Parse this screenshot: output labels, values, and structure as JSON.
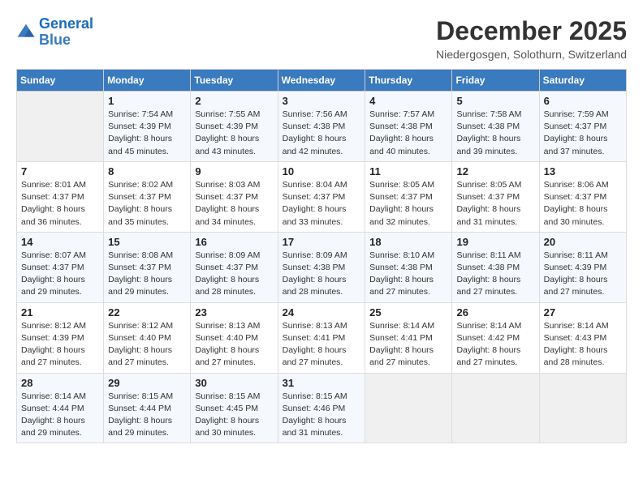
{
  "header": {
    "logo_line1": "General",
    "logo_line2": "Blue",
    "month_title": "December 2025",
    "location": "Niedergosgen, Solothurn, Switzerland"
  },
  "days_of_week": [
    "Sunday",
    "Monday",
    "Tuesday",
    "Wednesday",
    "Thursday",
    "Friday",
    "Saturday"
  ],
  "weeks": [
    [
      {
        "day": "",
        "sunrise": "",
        "sunset": "",
        "daylight": ""
      },
      {
        "day": "1",
        "sunrise": "Sunrise: 7:54 AM",
        "sunset": "Sunset: 4:39 PM",
        "daylight": "Daylight: 8 hours and 45 minutes."
      },
      {
        "day": "2",
        "sunrise": "Sunrise: 7:55 AM",
        "sunset": "Sunset: 4:39 PM",
        "daylight": "Daylight: 8 hours and 43 minutes."
      },
      {
        "day": "3",
        "sunrise": "Sunrise: 7:56 AM",
        "sunset": "Sunset: 4:38 PM",
        "daylight": "Daylight: 8 hours and 42 minutes."
      },
      {
        "day": "4",
        "sunrise": "Sunrise: 7:57 AM",
        "sunset": "Sunset: 4:38 PM",
        "daylight": "Daylight: 8 hours and 40 minutes."
      },
      {
        "day": "5",
        "sunrise": "Sunrise: 7:58 AM",
        "sunset": "Sunset: 4:38 PM",
        "daylight": "Daylight: 8 hours and 39 minutes."
      },
      {
        "day": "6",
        "sunrise": "Sunrise: 7:59 AM",
        "sunset": "Sunset: 4:37 PM",
        "daylight": "Daylight: 8 hours and 37 minutes."
      }
    ],
    [
      {
        "day": "7",
        "sunrise": "Sunrise: 8:01 AM",
        "sunset": "Sunset: 4:37 PM",
        "daylight": "Daylight: 8 hours and 36 minutes."
      },
      {
        "day": "8",
        "sunrise": "Sunrise: 8:02 AM",
        "sunset": "Sunset: 4:37 PM",
        "daylight": "Daylight: 8 hours and 35 minutes."
      },
      {
        "day": "9",
        "sunrise": "Sunrise: 8:03 AM",
        "sunset": "Sunset: 4:37 PM",
        "daylight": "Daylight: 8 hours and 34 minutes."
      },
      {
        "day": "10",
        "sunrise": "Sunrise: 8:04 AM",
        "sunset": "Sunset: 4:37 PM",
        "daylight": "Daylight: 8 hours and 33 minutes."
      },
      {
        "day": "11",
        "sunrise": "Sunrise: 8:05 AM",
        "sunset": "Sunset: 4:37 PM",
        "daylight": "Daylight: 8 hours and 32 minutes."
      },
      {
        "day": "12",
        "sunrise": "Sunrise: 8:05 AM",
        "sunset": "Sunset: 4:37 PM",
        "daylight": "Daylight: 8 hours and 31 minutes."
      },
      {
        "day": "13",
        "sunrise": "Sunrise: 8:06 AM",
        "sunset": "Sunset: 4:37 PM",
        "daylight": "Daylight: 8 hours and 30 minutes."
      }
    ],
    [
      {
        "day": "14",
        "sunrise": "Sunrise: 8:07 AM",
        "sunset": "Sunset: 4:37 PM",
        "daylight": "Daylight: 8 hours and 29 minutes."
      },
      {
        "day": "15",
        "sunrise": "Sunrise: 8:08 AM",
        "sunset": "Sunset: 4:37 PM",
        "daylight": "Daylight: 8 hours and 29 minutes."
      },
      {
        "day": "16",
        "sunrise": "Sunrise: 8:09 AM",
        "sunset": "Sunset: 4:37 PM",
        "daylight": "Daylight: 8 hours and 28 minutes."
      },
      {
        "day": "17",
        "sunrise": "Sunrise: 8:09 AM",
        "sunset": "Sunset: 4:38 PM",
        "daylight": "Daylight: 8 hours and 28 minutes."
      },
      {
        "day": "18",
        "sunrise": "Sunrise: 8:10 AM",
        "sunset": "Sunset: 4:38 PM",
        "daylight": "Daylight: 8 hours and 27 minutes."
      },
      {
        "day": "19",
        "sunrise": "Sunrise: 8:11 AM",
        "sunset": "Sunset: 4:38 PM",
        "daylight": "Daylight: 8 hours and 27 minutes."
      },
      {
        "day": "20",
        "sunrise": "Sunrise: 8:11 AM",
        "sunset": "Sunset: 4:39 PM",
        "daylight": "Daylight: 8 hours and 27 minutes."
      }
    ],
    [
      {
        "day": "21",
        "sunrise": "Sunrise: 8:12 AM",
        "sunset": "Sunset: 4:39 PM",
        "daylight": "Daylight: 8 hours and 27 minutes."
      },
      {
        "day": "22",
        "sunrise": "Sunrise: 8:12 AM",
        "sunset": "Sunset: 4:40 PM",
        "daylight": "Daylight: 8 hours and 27 minutes."
      },
      {
        "day": "23",
        "sunrise": "Sunrise: 8:13 AM",
        "sunset": "Sunset: 4:40 PM",
        "daylight": "Daylight: 8 hours and 27 minutes."
      },
      {
        "day": "24",
        "sunrise": "Sunrise: 8:13 AM",
        "sunset": "Sunset: 4:41 PM",
        "daylight": "Daylight: 8 hours and 27 minutes."
      },
      {
        "day": "25",
        "sunrise": "Sunrise: 8:14 AM",
        "sunset": "Sunset: 4:41 PM",
        "daylight": "Daylight: 8 hours and 27 minutes."
      },
      {
        "day": "26",
        "sunrise": "Sunrise: 8:14 AM",
        "sunset": "Sunset: 4:42 PM",
        "daylight": "Daylight: 8 hours and 27 minutes."
      },
      {
        "day": "27",
        "sunrise": "Sunrise: 8:14 AM",
        "sunset": "Sunset: 4:43 PM",
        "daylight": "Daylight: 8 hours and 28 minutes."
      }
    ],
    [
      {
        "day": "28",
        "sunrise": "Sunrise: 8:14 AM",
        "sunset": "Sunset: 4:44 PM",
        "daylight": "Daylight: 8 hours and 29 minutes."
      },
      {
        "day": "29",
        "sunrise": "Sunrise: 8:15 AM",
        "sunset": "Sunset: 4:44 PM",
        "daylight": "Daylight: 8 hours and 29 minutes."
      },
      {
        "day": "30",
        "sunrise": "Sunrise: 8:15 AM",
        "sunset": "Sunset: 4:45 PM",
        "daylight": "Daylight: 8 hours and 30 minutes."
      },
      {
        "day": "31",
        "sunrise": "Sunrise: 8:15 AM",
        "sunset": "Sunset: 4:46 PM",
        "daylight": "Daylight: 8 hours and 31 minutes."
      },
      {
        "day": "",
        "sunrise": "",
        "sunset": "",
        "daylight": ""
      },
      {
        "day": "",
        "sunrise": "",
        "sunset": "",
        "daylight": ""
      },
      {
        "day": "",
        "sunrise": "",
        "sunset": "",
        "daylight": ""
      }
    ]
  ]
}
